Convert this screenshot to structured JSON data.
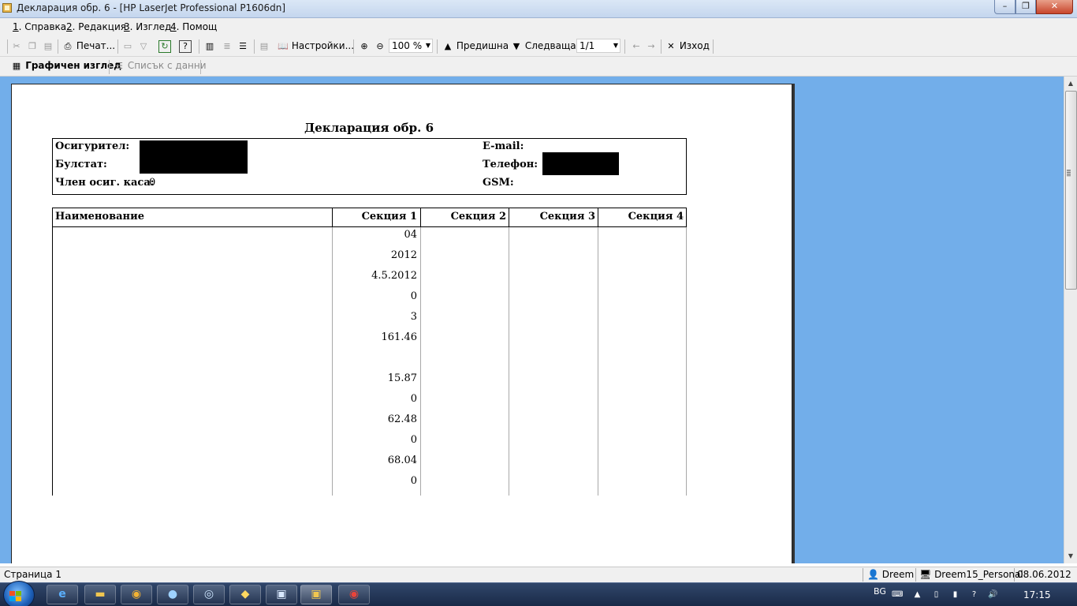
{
  "window": {
    "title": "Декларация обр. 6 - [HP LaserJet Professional P1606dn]",
    "minimize": "–",
    "maximize": "❐",
    "close": "✕"
  },
  "menu": {
    "items": [
      {
        "key": "1",
        "label": ". Справка"
      },
      {
        "key": "2",
        "label": ". Редакция"
      },
      {
        "key": "3",
        "label": ". Изглед"
      },
      {
        "key": "4",
        "label": ". Помощ"
      }
    ]
  },
  "toolbar": {
    "print_label": "Печат...",
    "settings_label": "Настройки...",
    "zoom_value": "100 %",
    "prev_label": "Предишна",
    "next_label": "Следваща",
    "page_value": "1/1",
    "exit_label": "Изход"
  },
  "tabs": {
    "graphic": "Графичен изглед",
    "data_list": "Списък с данни"
  },
  "document": {
    "title": "Декларация обр. 6",
    "insurer_label": "Осигурител:",
    "bulstat_label": "Булстат:",
    "member_label": "Член осиг. каса:",
    "member_value": "0",
    "email_label": "E-mail:",
    "phone_label": "Телефон:",
    "gsm_label": "GSM:",
    "columns": [
      "Наименование",
      "Секция 1",
      "Секция 2",
      "Секция 3",
      "Секция 4"
    ],
    "section1_values": [
      "04",
      "2012",
      "4.5.2012",
      "0",
      "3",
      "161.46",
      "",
      "15.87",
      "0",
      "62.48",
      "0",
      "68.04",
      "0"
    ]
  },
  "statusbar": {
    "page": "Страница 1",
    "user": "Dreem",
    "database": "Dreem15_Personal",
    "date": "08.06.2012"
  },
  "taskbar": {
    "lang": "BG",
    "time": "17:15"
  },
  "colors": {
    "preview_bg": "#72aeea",
    "taskbar": "#1f3152"
  }
}
